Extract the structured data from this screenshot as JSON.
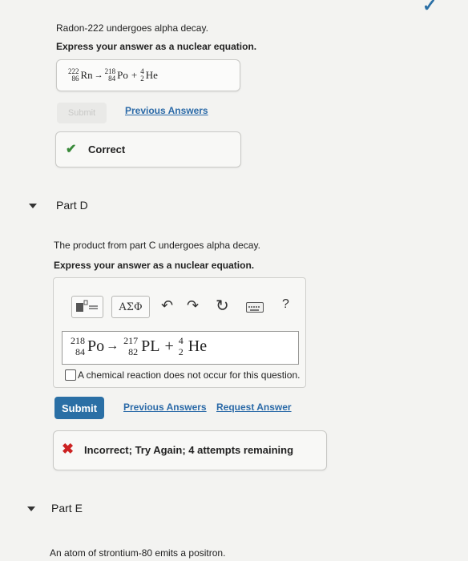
{
  "top_checkmark": "✓",
  "partC": {
    "question": "Radon-222 undergoes alpha decay.",
    "instruction": "Express your answer as a nuclear equation.",
    "answer": {
      "reactant": {
        "mass": "222",
        "atomic": "86",
        "symbol": "Rn"
      },
      "arrow": "→",
      "product1": {
        "mass": "218",
        "atomic": "84",
        "symbol": "Po"
      },
      "plus": "+",
      "product2": {
        "mass": "4",
        "atomic": "2",
        "symbol": "He"
      }
    },
    "submit_label": "Submit",
    "previous_answers_label": "Previous Answers",
    "feedback_label": "Correct"
  },
  "partD": {
    "header": "Part D",
    "question": "The product from part C undergoes alpha decay.",
    "instruction": "Express your answer as a nuclear equation.",
    "toolbar": {
      "greek_label": "ΑΣΦ",
      "help_label": "?"
    },
    "input": {
      "reactant": {
        "mass": "218",
        "atomic": "84",
        "symbol": "Po"
      },
      "arrow": "→",
      "product1": {
        "mass": "217",
        "atomic": "82",
        "symbol": "PL"
      },
      "plus": "+",
      "product2": {
        "mass": "4",
        "atomic": "2",
        "symbol": "He"
      }
    },
    "no_reaction_label": "A chemical reaction does not occur for this question.",
    "submit_label": "Submit",
    "previous_answers_label": "Previous Answers",
    "request_answer_label": "Request Answer",
    "feedback_label": "Incorrect; Try Again; 4 attempts remaining"
  },
  "partE": {
    "header": "Part E",
    "question": "An atom of strontium-80 emits a positron."
  },
  "colors": {
    "correct_green": "#3a8a3a",
    "incorrect_red": "#cc2222",
    "submit_blue": "#2a6fa5",
    "link_blue": "#2b6aa8"
  }
}
